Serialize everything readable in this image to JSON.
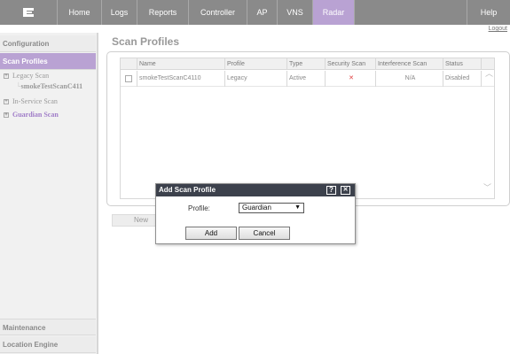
{
  "nav": {
    "items": [
      {
        "label": "Home"
      },
      {
        "label": "Logs"
      },
      {
        "label": "Reports"
      },
      {
        "label": "Controller"
      },
      {
        "label": "AP"
      },
      {
        "label": "VNS"
      },
      {
        "label": "Radar"
      },
      {
        "label": "Help"
      }
    ],
    "active": "Radar",
    "logout": "Logout"
  },
  "sidebar": {
    "configuration": "Configuration",
    "scan_profiles": "Scan Profiles",
    "tree": {
      "legacy_scan": "Legacy Scan",
      "legacy_child": "smokeTestScanC411",
      "in_service_scan": "In-Service Scan",
      "guardian_scan": "Guardian Scan"
    },
    "maintenance": "Maintenance",
    "location_engine": "Location Engine"
  },
  "main": {
    "title": "Scan Profiles",
    "columns": [
      "Name",
      "Profile",
      "Type",
      "Security Scan",
      "Interference Scan",
      "Status"
    ],
    "rows": [
      {
        "name": "smokeTestScanC4110",
        "profile": "Legacy",
        "type": "Active",
        "security_scan": "✕",
        "interference_scan": "N/A",
        "status": "Disabled"
      }
    ],
    "new_button": "New"
  },
  "dialog": {
    "title": "Add Scan Profile",
    "help_icon": "?",
    "close_icon": "✕",
    "profile_label": "Profile:",
    "profile_value": "Guardian",
    "add_button": "Add",
    "cancel_button": "Cancel"
  },
  "colors": {
    "nav_bg": "#8a8a8a",
    "nav_active": "#b9a2d3",
    "dialog_bar": "#3c414c",
    "accent_purple": "#a07dc8",
    "error_x": "#e04040"
  }
}
